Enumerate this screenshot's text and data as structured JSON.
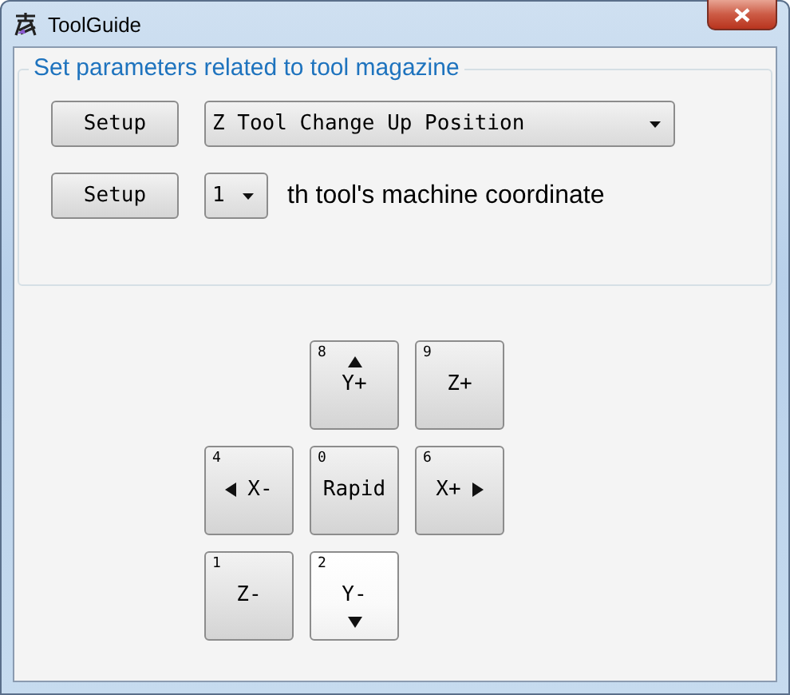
{
  "window": {
    "title": "ToolGuide"
  },
  "group": {
    "title": "Set parameters related to tool magazine",
    "rows": [
      {
        "button": "Setup",
        "select": "Z Tool Change Up Position"
      },
      {
        "button": "Setup",
        "select": "1",
        "suffix": "th tool's machine coordinate"
      }
    ]
  },
  "jog_rows": [
    {
      "kind": "top",
      "keys": [
        {
          "hotkey": "8",
          "label": "Y+",
          "kind": "arrow-up",
          "hovered": false
        },
        {
          "hotkey": "9",
          "label": "Z+",
          "kind": "plain",
          "hovered": false
        }
      ]
    },
    {
      "kind": "middle",
      "keys": [
        {
          "hotkey": "4",
          "label": "X-",
          "kind": "arrow-left",
          "hovered": false
        },
        {
          "hotkey": "0",
          "label": "Rapid",
          "kind": "plain",
          "hovered": false
        },
        {
          "hotkey": "6",
          "label": "X+",
          "kind": "arrow-right",
          "hovered": false
        }
      ]
    },
    {
      "kind": "bottom",
      "keys": [
        {
          "hotkey": "1",
          "label": "Z-",
          "kind": "plain",
          "hovered": false
        },
        {
          "hotkey": "2",
          "label": "Y-",
          "kind": "arrow-down",
          "hovered": true
        }
      ]
    }
  ]
}
